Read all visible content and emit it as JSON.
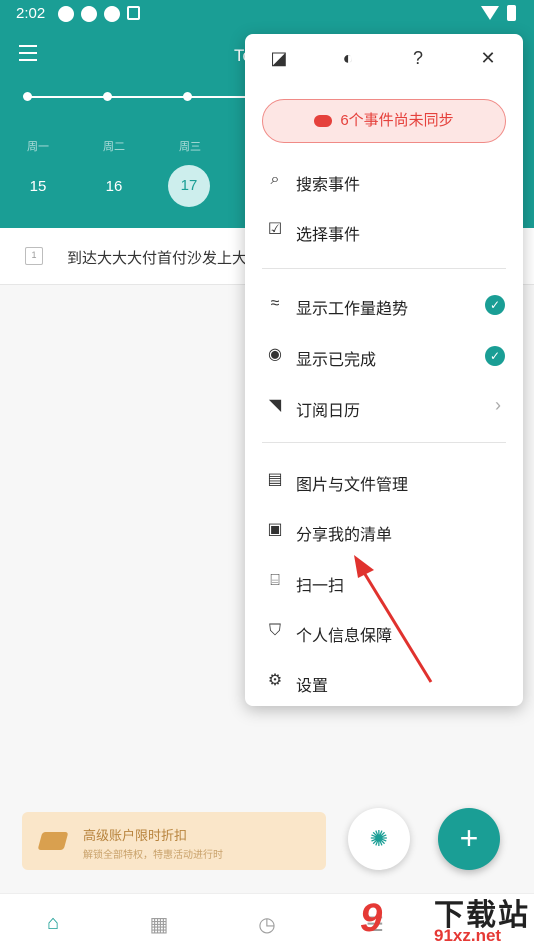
{
  "status_bar": {
    "time": "2:02"
  },
  "header": {
    "title": "To",
    "weekdays": [
      "周一",
      "周二",
      "周三"
    ],
    "days": [
      "15",
      "16",
      "17"
    ]
  },
  "task": {
    "text": "到达大大大付首付沙发上大",
    "box_label": "1"
  },
  "menu": {
    "sync_label": "6个事件尚未同步",
    "items": [
      {
        "label": "搜索事件",
        "icon": "search-icon"
      },
      {
        "label": "选择事件",
        "icon": "checkbox-icon"
      },
      {
        "label": "显示工作量趋势",
        "icon": "trend-icon",
        "checked": true
      },
      {
        "label": "显示已完成",
        "icon": "radio-icon",
        "checked": true
      },
      {
        "label": "订阅日历",
        "icon": "rss-icon",
        "chevron": true
      },
      {
        "label": "图片与文件管理",
        "icon": "file-icon"
      },
      {
        "label": "分享我的清单",
        "icon": "clipboard-icon"
      },
      {
        "label": "扫一扫",
        "icon": "scan-icon"
      },
      {
        "label": "个人信息保障",
        "icon": "shield-icon"
      },
      {
        "label": "设置",
        "icon": "gear-icon"
      }
    ]
  },
  "promo": {
    "title": "高级账户限时折扣",
    "subtitle": "解锁全部特权，特惠活动进行时"
  },
  "watermark": {
    "title": "下载站",
    "url": "91xz.net",
    "logo": "9"
  },
  "colors": {
    "primary": "#1a9e95",
    "sync_red": "#e5413c",
    "promo_bg": "#fae6c9",
    "arrow": "#e0322e"
  }
}
